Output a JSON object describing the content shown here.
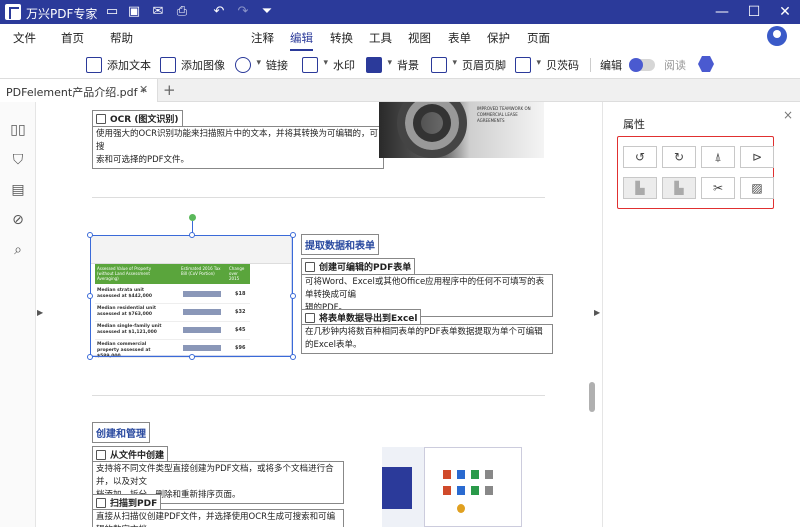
{
  "window": {
    "app_title": "万兴PDF专家",
    "min": "—",
    "max": "☐",
    "close": "✕"
  },
  "menu": {
    "left": [
      "文件",
      "首页",
      "帮助"
    ],
    "center": [
      "注释",
      "编辑",
      "转换",
      "工具",
      "视图",
      "表单",
      "保护",
      "页面"
    ],
    "active": "编辑"
  },
  "toolbar": {
    "add_text": "添加文本",
    "add_image": "添加图像",
    "link": "链接",
    "watermark": "水印",
    "background": "背景",
    "header_footer": "页眉页脚",
    "bates": "贝茨码",
    "edit_label": "编辑",
    "read_label": "阅读"
  },
  "tabs": {
    "doc_name": "PDFelement产品介绍.pdf *",
    "close": "✕",
    "add": "+"
  },
  "document": {
    "ocr": {
      "title": "OCR (图文识别)",
      "text1": "使用强大的OCR识别功能来扫描照片中的文本，并将其转换为可编辑的，可搜",
      "text2": "索和可选择的PDF文件。"
    },
    "extract": {
      "title": "提取数据和表单",
      "create_title": "创建可编辑的PDF表单",
      "create_text1": "可将Word、Excel或其他Office应用程序中的任何不可填写的表单转换成可编",
      "create_text2": "辑的PDF。",
      "export_title": "将表单数据导出到Excel",
      "export_text": "在几秒钟内将数百种相同表单的PDF表单数据提取为单个可编辑的Excel表单。"
    },
    "table_image": {
      "headers": [
        "Assessed Value of Property (without Land Assessment Averaging)",
        "Estimated 2016 Tax Bill (CoV Portion)",
        "Change over 2015"
      ],
      "rows": [
        {
          "label": "Median strata unit assessed at $442,000",
          "value": "$18"
        },
        {
          "label": "Median residential unit assessed at $763,000",
          "value": "$32"
        },
        {
          "label": "Median single-family unit assessed at $1,121,000",
          "value": "$45"
        },
        {
          "label": "Median commercial property assessed at $589,000",
          "value": "$96"
        }
      ]
    },
    "stair_image_text": "IMPROVED TEAMWORK ON COMMERCIAL LEASE AGREEMENTS",
    "manage": {
      "title": "创建和管理",
      "from_files_title": "从文件中创建",
      "from_files_text1": "支持将不同文件类型直接创建为PDF文档，或将多个文档进行合并，以及对文",
      "from_files_text2": "档添加，拆分，删除和重新排序页面。",
      "scan_title": "扫描到PDF",
      "scan_text": "直接从扫描仪创建PDF文件，并选择使用OCR生成可搜索和可编辑的数字文档"
    }
  },
  "panel": {
    "title": "属性",
    "close": "×",
    "buttons": [
      "rotate-left",
      "rotate-right",
      "flip-vertical",
      "flip-horizontal",
      "align-left",
      "align-bottom",
      "crop",
      "replace-image"
    ]
  }
}
